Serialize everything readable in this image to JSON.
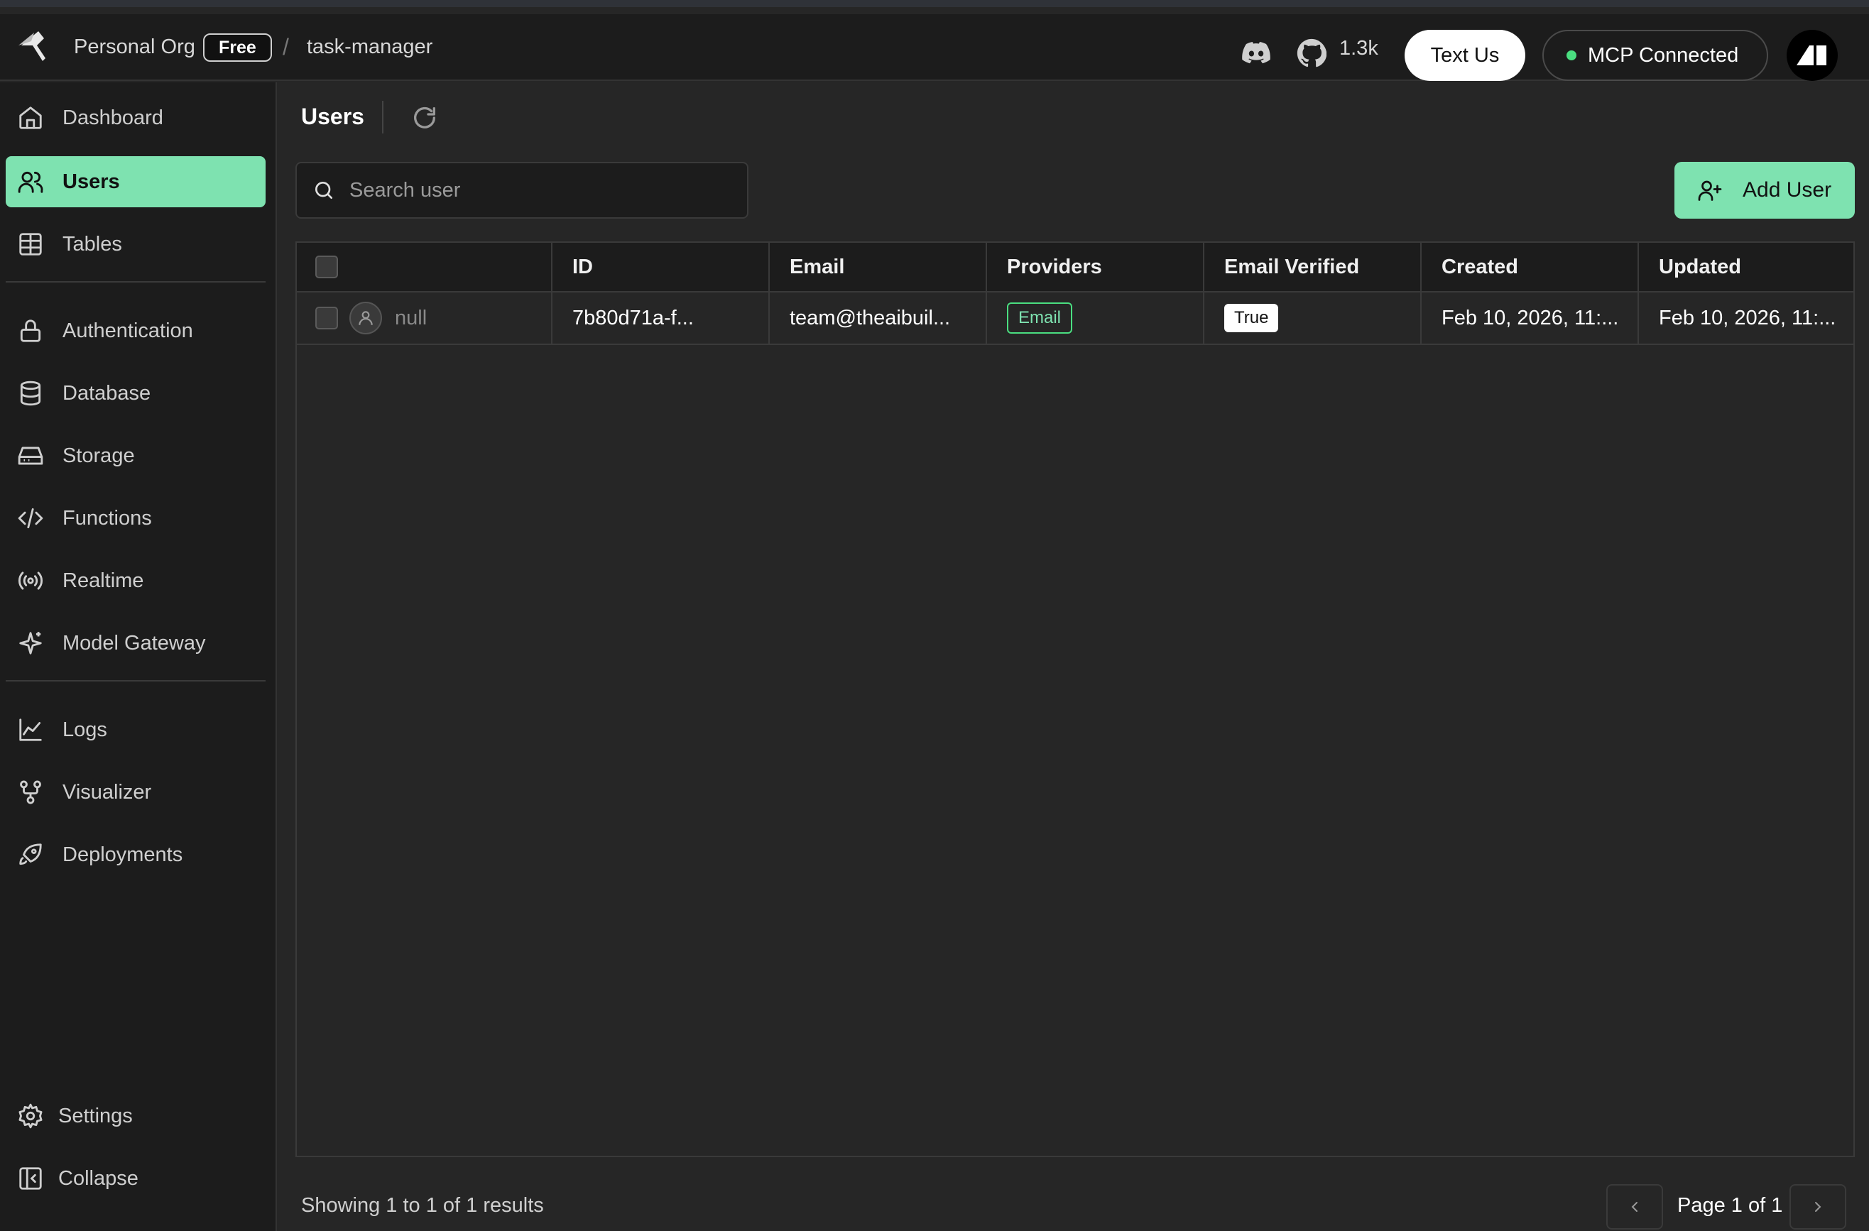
{
  "header": {
    "org": "Personal Org",
    "plan": "Free",
    "separator": "/",
    "project": "task-manager",
    "github_stars": "1.3k",
    "text_us": "Text Us",
    "mcp_status": "MCP Connected",
    "mcp_status_color": "#4ade80"
  },
  "sidebar": {
    "items": [
      {
        "label": "Dashboard",
        "icon": "home-icon"
      },
      {
        "label": "Users",
        "icon": "users-icon",
        "active": true
      },
      {
        "label": "Tables",
        "icon": "table-icon"
      },
      {
        "label": "Authentication",
        "icon": "lock-icon"
      },
      {
        "label": "Database",
        "icon": "database-icon"
      },
      {
        "label": "Storage",
        "icon": "storage-icon"
      },
      {
        "label": "Functions",
        "icon": "code-icon"
      },
      {
        "label": "Realtime",
        "icon": "broadcast-icon"
      },
      {
        "label": "Model Gateway",
        "icon": "sparkle-icon"
      },
      {
        "label": "Logs",
        "icon": "chart-line-icon"
      },
      {
        "label": "Visualizer",
        "icon": "graph-icon"
      },
      {
        "label": "Deployments",
        "icon": "rocket-icon"
      }
    ],
    "settings": "Settings",
    "collapse": "Collapse"
  },
  "main": {
    "title": "Users",
    "search_placeholder": "Search user",
    "add_user": "Add User",
    "columns": [
      "ID",
      "Email",
      "Providers",
      "Email Verified",
      "Created",
      "Updated"
    ],
    "rows": [
      {
        "name": "null",
        "id": "7b80d71a-f...",
        "email": "team@theaibuil...",
        "provider": "Email",
        "email_verified": "True",
        "created": "Feb 10, 2026, 11:...",
        "updated": "Feb 10, 2026, 11:..."
      }
    ],
    "showing": "Showing 1 to 1 of 1 results",
    "page": "Page 1 of 1"
  },
  "colors": {
    "accent": "#7ee2b0",
    "background": "#262626",
    "sidebar": "#1c1c1c"
  }
}
